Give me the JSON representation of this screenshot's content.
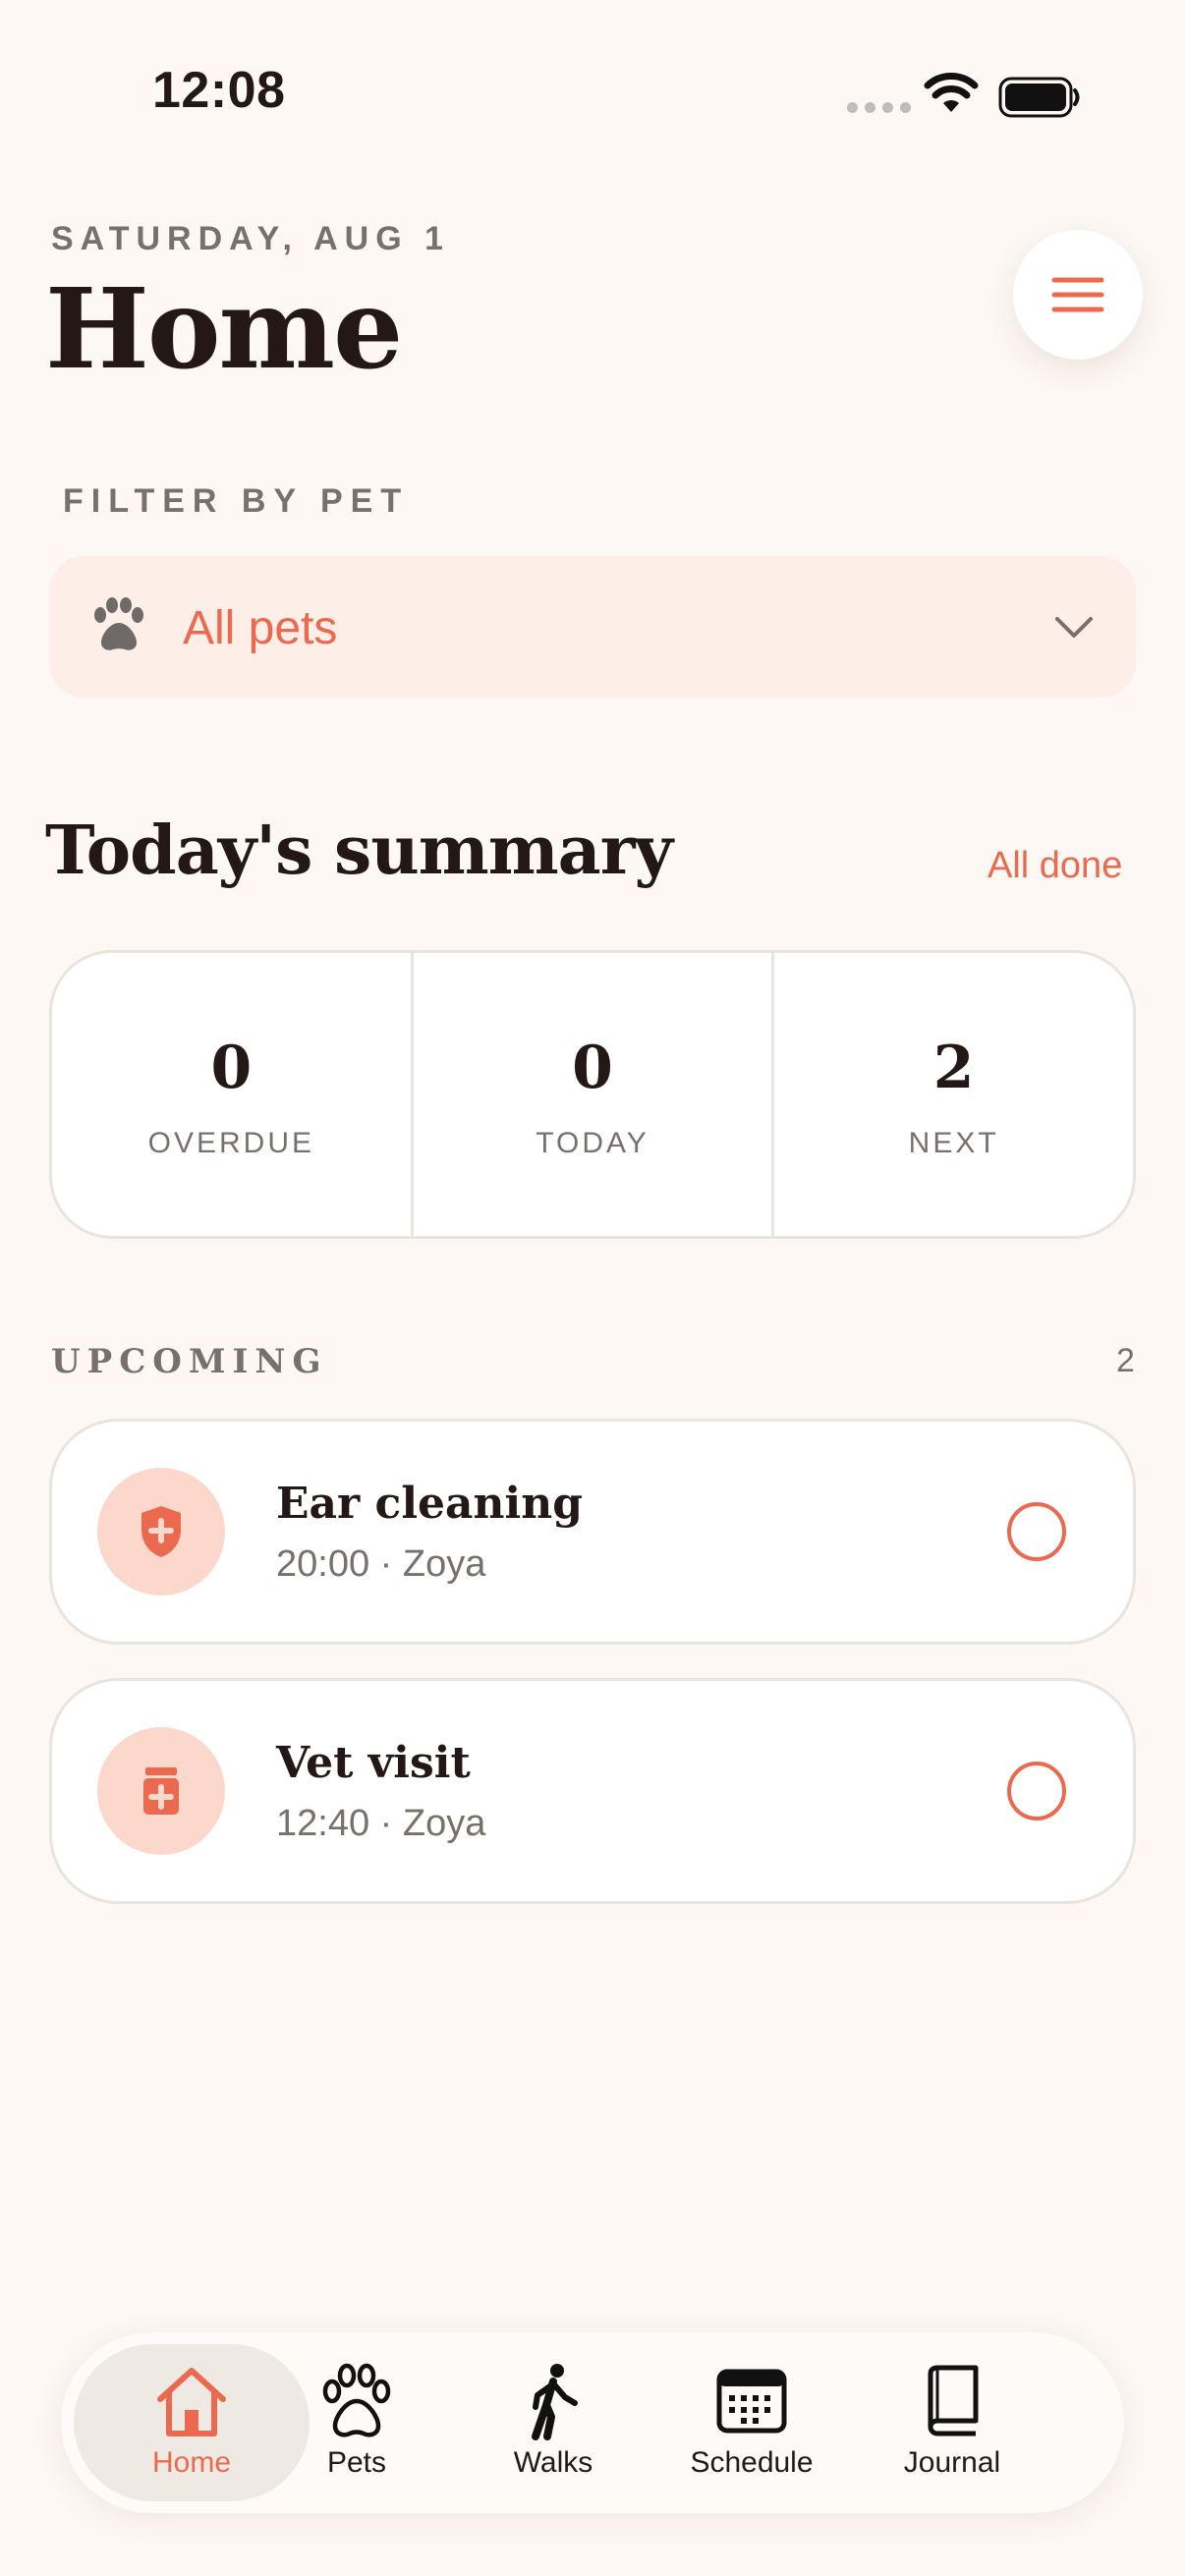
{
  "status_bar": {
    "time": "12:08"
  },
  "header": {
    "date": "SATURDAY, AUG 1",
    "title": "Home"
  },
  "filter": {
    "label": "FILTER BY PET",
    "value": "All pets",
    "icon": "paw-icon"
  },
  "summary": {
    "title": "Today's summary",
    "status": "All done",
    "stats": [
      {
        "value": "0",
        "label": "OVERDUE"
      },
      {
        "value": "0",
        "label": "TODAY"
      },
      {
        "value": "2",
        "label": "NEXT"
      }
    ]
  },
  "upcoming": {
    "label": "UPCOMING",
    "count": "2",
    "items": [
      {
        "title": "Ear cleaning",
        "subtitle": "20:00 · Zoya",
        "icon": "shield-plus-icon",
        "done": false
      },
      {
        "title": "Vet visit",
        "subtitle": "12:40 · Zoya",
        "icon": "medicine-bottle-icon",
        "done": false
      }
    ]
  },
  "tabs": [
    {
      "label": "Home",
      "icon": "home-icon",
      "active": true
    },
    {
      "label": "Pets",
      "icon": "paw-icon",
      "active": false
    },
    {
      "label": "Walks",
      "icon": "walking-person-icon",
      "active": false
    },
    {
      "label": "Schedule",
      "icon": "calendar-icon",
      "active": false
    },
    {
      "label": "Journal",
      "icon": "book-icon",
      "active": false
    }
  ],
  "colors": {
    "accent": "#eb6a4f",
    "background": "#fdf8f4",
    "icon_badge": "#fcd8cc",
    "text_primary": "#231815",
    "text_secondary": "#7a706b"
  }
}
